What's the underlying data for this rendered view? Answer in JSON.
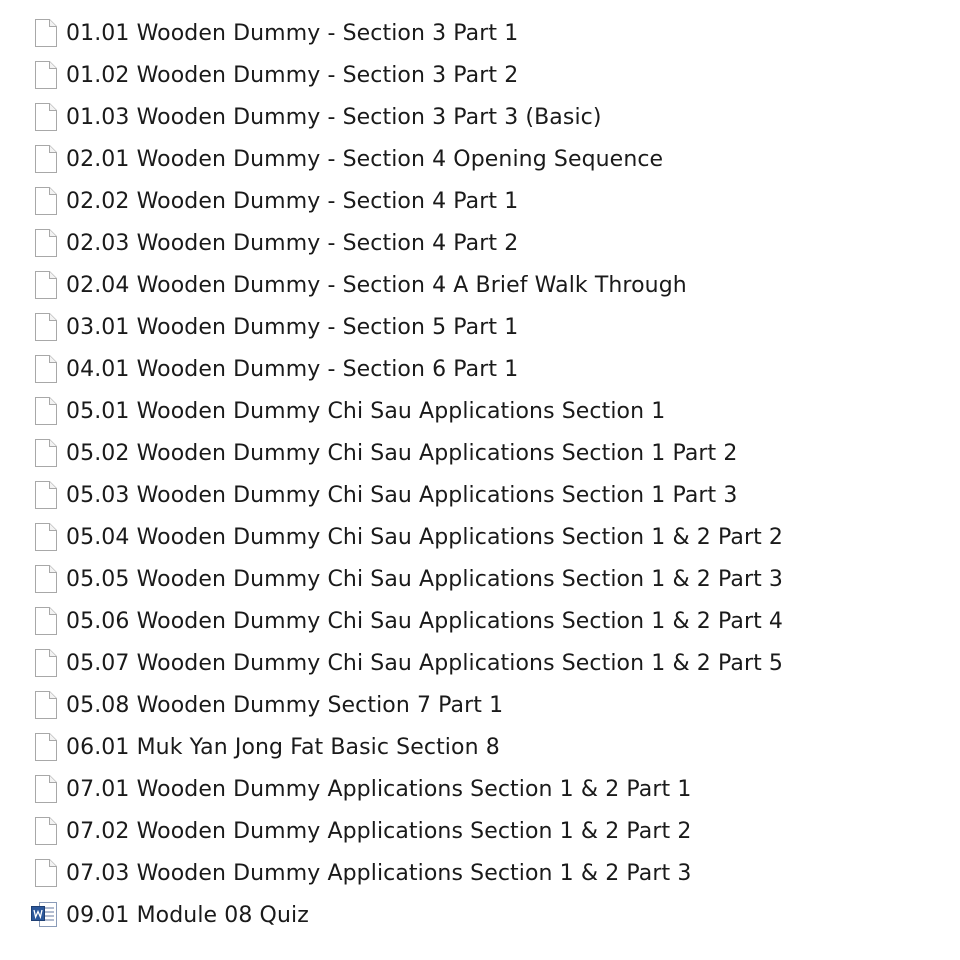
{
  "files": [
    {
      "name": "01.01 Wooden Dummy - Section 3 Part 1",
      "icon": "blank-file-icon"
    },
    {
      "name": "01.02 Wooden Dummy - Section 3 Part 2",
      "icon": "blank-file-icon"
    },
    {
      "name": "01.03 Wooden Dummy - Section 3 Part 3 (Basic)",
      "icon": "blank-file-icon"
    },
    {
      "name": "02.01 Wooden Dummy - Section 4 Opening Sequence",
      "icon": "blank-file-icon"
    },
    {
      "name": "02.02 Wooden Dummy - Section 4 Part 1",
      "icon": "blank-file-icon"
    },
    {
      "name": "02.03 Wooden Dummy - Section 4 Part 2",
      "icon": "blank-file-icon"
    },
    {
      "name": "02.04 Wooden Dummy - Section 4 A Brief Walk Through",
      "icon": "blank-file-icon"
    },
    {
      "name": "03.01 Wooden Dummy - Section 5 Part 1",
      "icon": "blank-file-icon"
    },
    {
      "name": "04.01 Wooden Dummy - Section 6 Part 1",
      "icon": "blank-file-icon"
    },
    {
      "name": "05.01 Wooden Dummy Chi Sau Applications Section 1",
      "icon": "blank-file-icon"
    },
    {
      "name": "05.02 Wooden Dummy Chi Sau Applications Section 1 Part 2",
      "icon": "blank-file-icon"
    },
    {
      "name": "05.03 Wooden Dummy Chi Sau Applications Section 1 Part 3",
      "icon": "blank-file-icon"
    },
    {
      "name": "05.04 Wooden Dummy Chi Sau Applications Section 1 & 2 Part 2",
      "icon": "blank-file-icon"
    },
    {
      "name": "05.05 Wooden Dummy Chi Sau Applications Section 1 & 2 Part 3",
      "icon": "blank-file-icon"
    },
    {
      "name": "05.06 Wooden Dummy Chi Sau Applications Section 1 & 2 Part 4",
      "icon": "blank-file-icon"
    },
    {
      "name": "05.07 Wooden Dummy Chi Sau Applications Section 1 & 2 Part 5",
      "icon": "blank-file-icon"
    },
    {
      "name": "05.08 Wooden Dummy Section 7 Part 1",
      "icon": "blank-file-icon"
    },
    {
      "name": "06.01 Muk Yan Jong Fat Basic Section 8",
      "icon": "blank-file-icon"
    },
    {
      "name": "07.01 Wooden Dummy Applications Section 1 & 2 Part 1",
      "icon": "blank-file-icon"
    },
    {
      "name": "07.02 Wooden Dummy Applications Section 1 & 2 Part 2",
      "icon": "blank-file-icon"
    },
    {
      "name": "07.03 Wooden Dummy Applications Section 1 & 2 Part 3",
      "icon": "blank-file-icon"
    },
    {
      "name": "09.01 Module 08 Quiz",
      "icon": "word-document-icon"
    }
  ],
  "colors": {
    "text": "#1a1a1a",
    "icon_border": "#a8a8a8",
    "icon_fill": "#ffffff",
    "word_blue": "#2b579a"
  }
}
